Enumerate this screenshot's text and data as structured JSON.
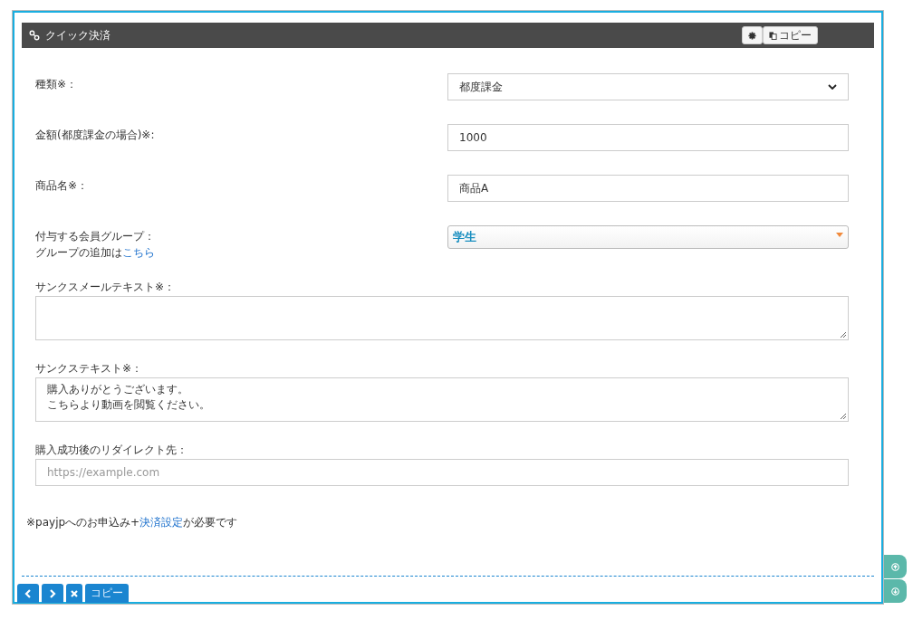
{
  "panel": {
    "title": "クイック決済",
    "copy_button": "コピー"
  },
  "fields": [
    {
      "kind": "select",
      "label": "種類※：",
      "value": "都度課金"
    },
    {
      "kind": "input",
      "label": "金額(都度課金の場合)※:",
      "value": "1000"
    },
    {
      "kind": "input",
      "label": "商品名※：",
      "value": "商品A"
    },
    {
      "kind": "tagselect",
      "label": "付与する会員グループ：",
      "note": "グループの追加は",
      "link": "こちら",
      "value": "学生"
    },
    {
      "kind": "textarea",
      "label": "サンクスメールテキスト※："
    },
    {
      "kind": "textarea",
      "label": "サンクステキスト※：",
      "lines": [
        "購入ありがとうございます。",
        "こちらより動画を閲覧ください。"
      ]
    },
    {
      "kind": "input-wide",
      "label": "購入成功後のリダイレクト先：",
      "placeholder": "https://example.com"
    }
  ],
  "footer_note": {
    "before": "※payjpへのお申込み+",
    "link": "決済設定",
    "after": "が必要です"
  },
  "toolbar": {
    "copy": "コピー"
  }
}
